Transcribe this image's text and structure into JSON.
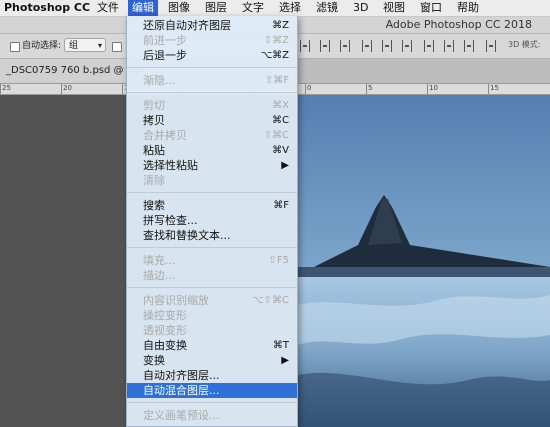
{
  "menubar": {
    "items": [
      "Photoshop CC",
      "文件",
      "编辑",
      "图像",
      "图层",
      "文字",
      "选择",
      "滤镜",
      "3D",
      "视图",
      "窗口",
      "帮助"
    ]
  },
  "window": {
    "title": "Adobe Photoshop CC 2018"
  },
  "options": {
    "auto_select_label": "自动选择:",
    "auto_select_value": "组",
    "mode_3d_label": "3D 模式:"
  },
  "document": {
    "tab_title": "_DSC0759 760 b.psd @ 10"
  },
  "ruler": {
    "labels": [
      "25",
      "20",
      "15",
      "10",
      "5",
      "0",
      "5",
      "10",
      "15"
    ]
  },
  "edit_menu": {
    "items": [
      {
        "label": "还原自动对齐图层",
        "shortcut": "⌘Z",
        "disabled": false
      },
      {
        "label": "前进一步",
        "shortcut": "⇧⌘Z",
        "disabled": true
      },
      {
        "label": "后退一步",
        "shortcut": "⌥⌘Z",
        "disabled": false
      },
      {
        "label": "渐隐...",
        "shortcut": "⇧⌘F",
        "disabled": true
      },
      {
        "label": "剪切",
        "shortcut": "⌘X",
        "disabled": true
      },
      {
        "label": "拷贝",
        "shortcut": "⌘C",
        "disabled": false
      },
      {
        "label": "合并拷贝",
        "shortcut": "⇧⌘C",
        "disabled": true
      },
      {
        "label": "粘贴",
        "shortcut": "⌘V",
        "disabled": false
      },
      {
        "label": "选择性粘贴",
        "shortcut": "▶",
        "disabled": false
      },
      {
        "label": "清除",
        "shortcut": "",
        "disabled": true
      },
      {
        "label": "搜索",
        "shortcut": "⌘F",
        "disabled": false
      },
      {
        "label": "拼写检查...",
        "shortcut": "",
        "disabled": false
      },
      {
        "label": "查找和替换文本...",
        "shortcut": "",
        "disabled": false
      },
      {
        "label": "填充...",
        "shortcut": "⇧F5",
        "disabled": true
      },
      {
        "label": "描边...",
        "shortcut": "",
        "disabled": true
      },
      {
        "label": "内容识别缩放",
        "shortcut": "⌥⇧⌘C",
        "disabled": true
      },
      {
        "label": "操控变形",
        "shortcut": "",
        "disabled": true
      },
      {
        "label": "透视变形",
        "shortcut": "",
        "disabled": true
      },
      {
        "label": "自由变换",
        "shortcut": "⌘T",
        "disabled": false
      },
      {
        "label": "变换",
        "shortcut": "▶",
        "disabled": false
      },
      {
        "label": "自动对齐图层...",
        "shortcut": "",
        "disabled": false
      },
      {
        "label": "自动混合图层...",
        "shortcut": "",
        "disabled": false,
        "selected": true
      },
      {
        "label": "定义画笔预设...",
        "shortcut": "",
        "disabled": true
      }
    ]
  },
  "colors": {
    "menu_highlight": "#2f6fd8",
    "menubar_active": "#2e63d6",
    "sky_top": "#5b87b9",
    "ice": "#9fc2de"
  }
}
